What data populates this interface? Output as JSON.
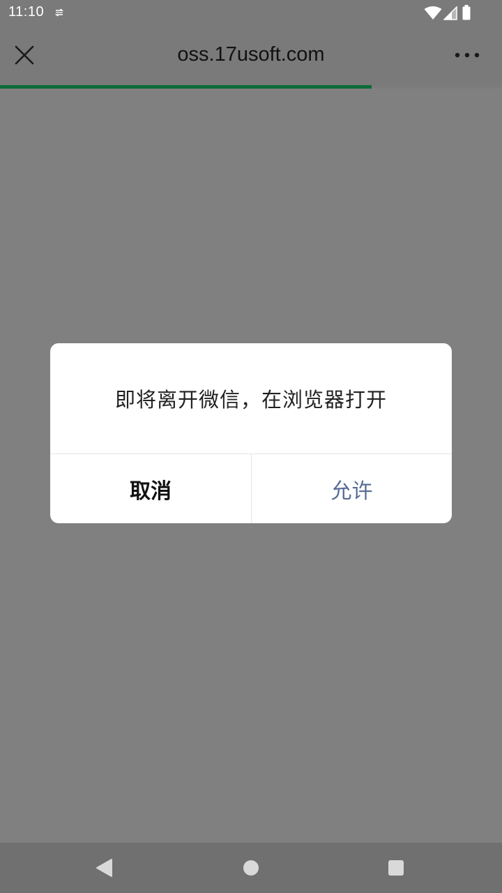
{
  "status_bar": {
    "time": "11:10",
    "icons": [
      "sync-icon",
      "wifi-icon",
      "signal-icon",
      "battery-icon"
    ]
  },
  "title_bar": {
    "title": "oss.17usoft.com",
    "icons": [
      "close-icon",
      "more-icon"
    ],
    "progress": 0.74,
    "progress_color": "#0e6b3a"
  },
  "dialog": {
    "message": "即将离开微信，在浏览器打开",
    "cancel_label": "取消",
    "allow_label": "允许",
    "allow_color": "#576b95"
  },
  "nav_bar": {
    "icons": [
      "back-icon",
      "home-icon",
      "recents-icon"
    ]
  }
}
